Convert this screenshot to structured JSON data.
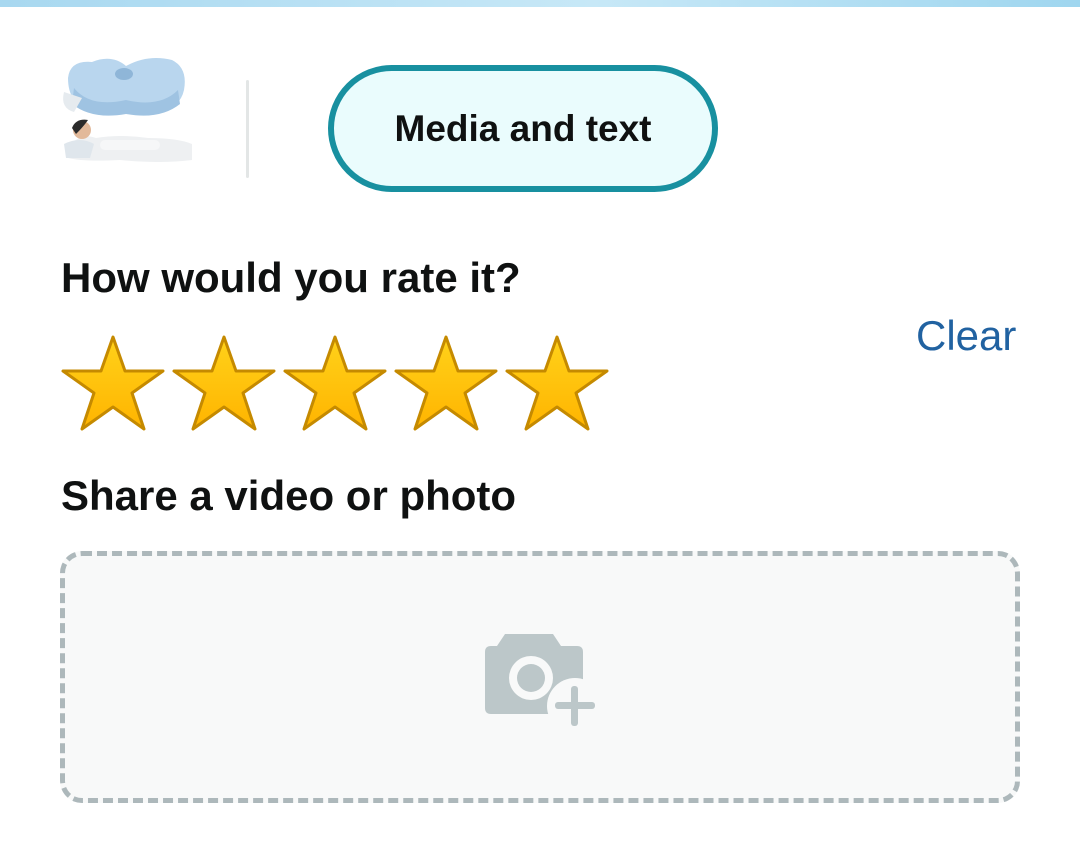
{
  "header": {
    "product_thumbnail": "pillow-product-image",
    "tab_active_label": "Media and text"
  },
  "rating": {
    "title": "How would you rate it?",
    "clear_label": "Clear",
    "value": 5,
    "max": 5
  },
  "media": {
    "title": "Share a video or photo",
    "upload_icon": "camera-add-icon"
  },
  "colors": {
    "accent": "#1890a0",
    "star_fill": "#ffb400",
    "star_stroke": "#c58a00",
    "link": "#2162a1"
  }
}
